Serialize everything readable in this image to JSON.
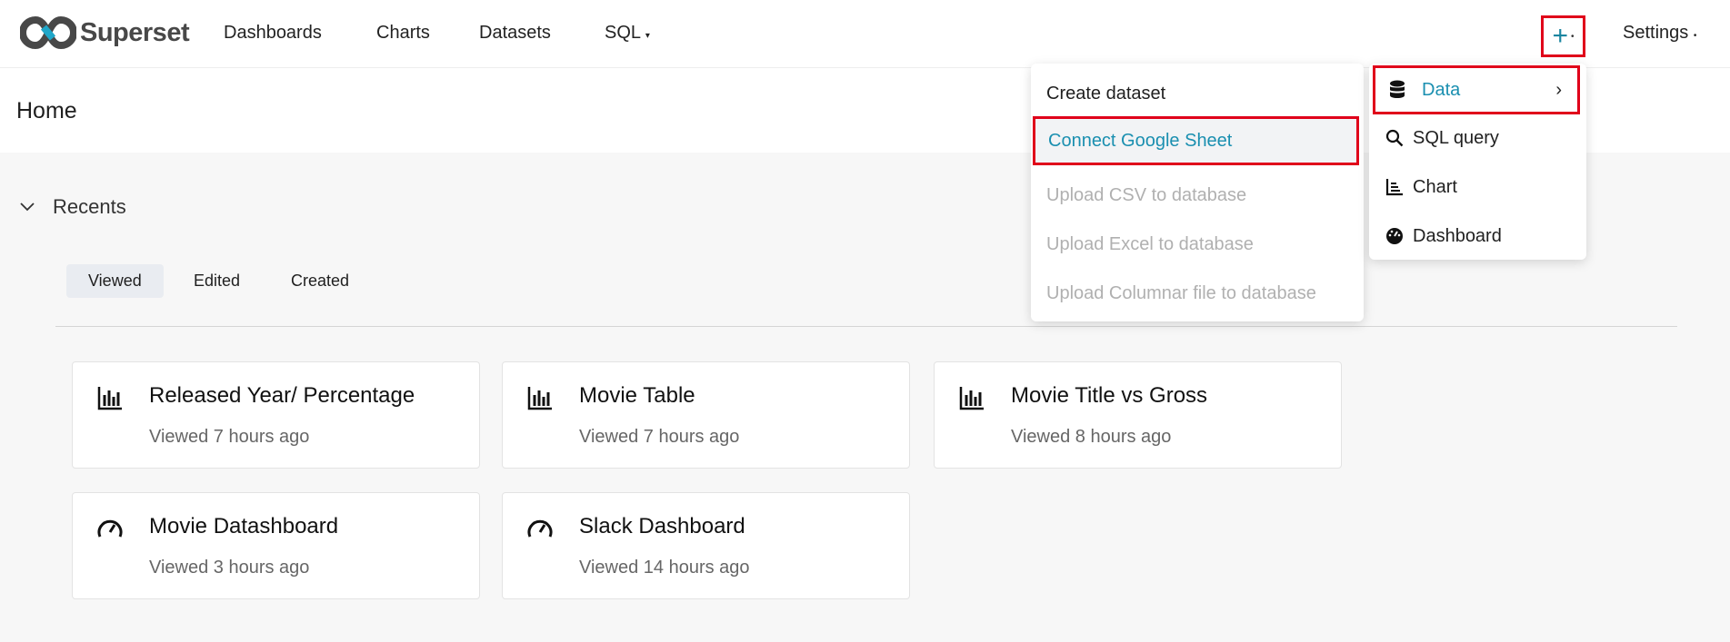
{
  "brand": "Superset",
  "nav": {
    "items": [
      "Dashboards",
      "Charts",
      "Datasets",
      "SQL"
    ],
    "settings": "Settings",
    "plus": "+"
  },
  "page_title": "Home",
  "recents": {
    "title": "Recents",
    "tabs": [
      "Viewed",
      "Edited",
      "Created"
    ],
    "cards": [
      {
        "icon": "bar-chart-icon",
        "title": "Released Year/ Percentage",
        "sub": "Viewed 7 hours ago"
      },
      {
        "icon": "bar-chart-icon",
        "title": "Movie Table",
        "sub": "Viewed 7 hours ago"
      },
      {
        "icon": "bar-chart-icon",
        "title": "Movie Title vs Gross",
        "sub": "Viewed 8 hours ago"
      },
      {
        "icon": "dashboard-gauge-icon",
        "title": "Movie Datashboard",
        "sub": "Viewed 3 hours ago"
      },
      {
        "icon": "dashboard-gauge-icon",
        "title": "Slack Dashboard",
        "sub": "Viewed 14 hours ago"
      }
    ]
  },
  "new_menu": {
    "items": [
      "Data",
      "SQL query",
      "Chart",
      "Dashboard"
    ]
  },
  "data_submenu": {
    "items": [
      "Create dataset",
      "Connect Google Sheet",
      "Upload CSV to database",
      "Upload Excel to database",
      "Upload Columnar file to database"
    ]
  },
  "colors": {
    "accent": "#1a8fb0",
    "highlight": "#e0001a"
  }
}
